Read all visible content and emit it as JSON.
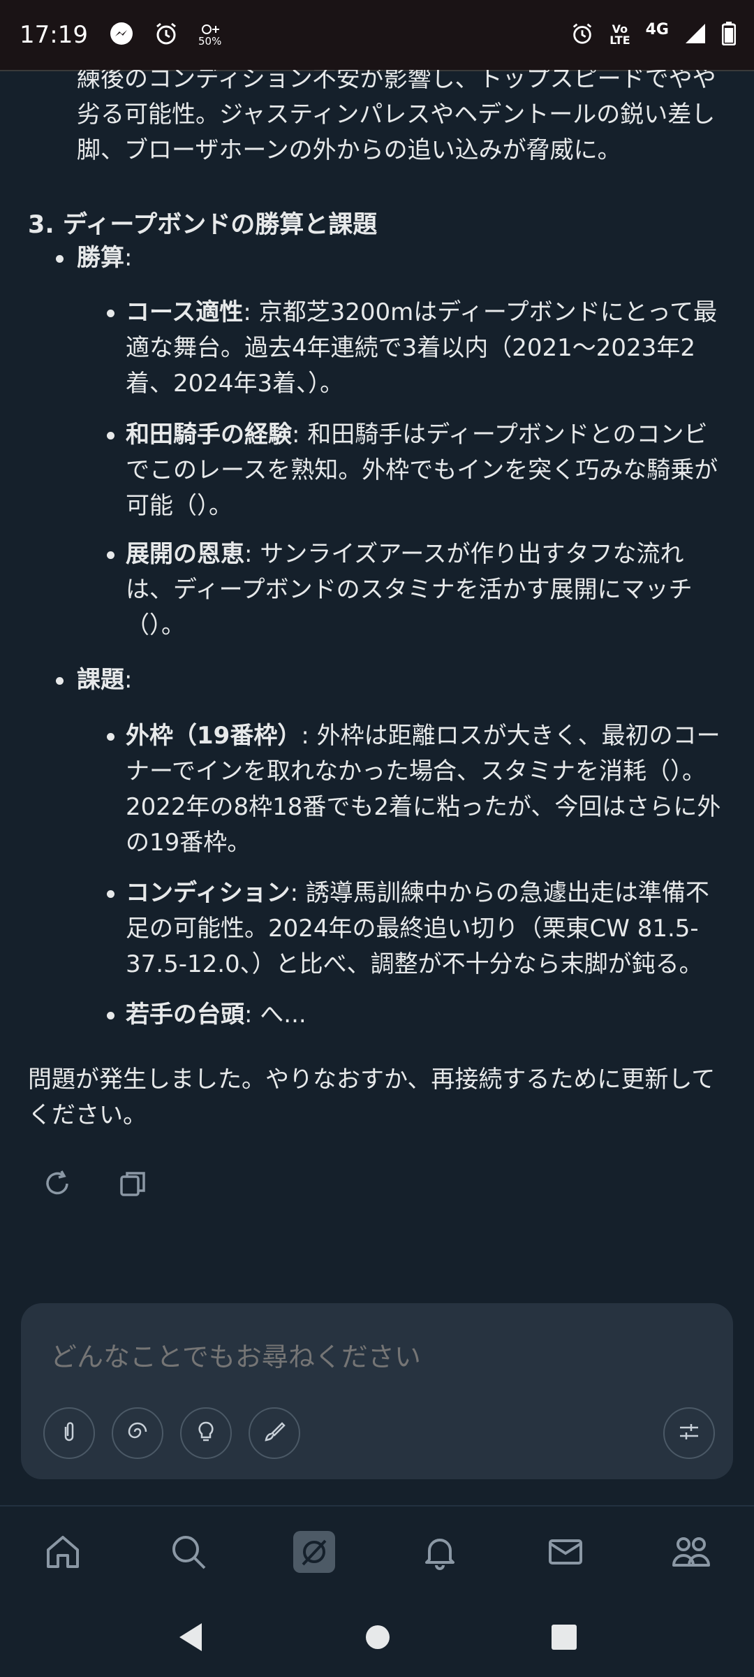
{
  "status_bar": {
    "time": "17:19",
    "icons_left": [
      "messenger-icon",
      "alarm-icon",
      "data-saver-icon"
    ],
    "data_saver_label": "50%",
    "icons_right": [
      "alarm-icon",
      "volte-icon",
      "signal-icon",
      "battery-icon"
    ],
    "volte_top": "Vo",
    "volte_bottom": "LTE",
    "network": "4G"
  },
  "message": {
    "continued_paragraph": "練後のコンディション不安が影響し、トップスピードでやや劣る可能性。ジャスティンパレスやヘデントールの鋭い差し脚、ブローザホーンの外からの追い込みが脅威に。",
    "section_title": "3. ディープボンドの勝算と課題",
    "strengths": {
      "label": "勝算",
      "colon": ":",
      "items": [
        {
          "title": "コース適性",
          "text": ": 京都芝3200mはディープボンドにとって最適な舞台。過去4年連続で3着以内（2021〜2023年2着、2024年3着、）。"
        },
        {
          "title": "和田騎手の経験",
          "text": ": 和田騎手はディープボンドとのコンビでこのレースを熟知。外枠でもインを突く巧みな騎乗が可能（）。"
        },
        {
          "title": "展開の恩恵",
          "text": ": サンライズアースが作り出すタフな流れは、ディープボンドのスタミナを活かす展開にマッチ（）。"
        }
      ]
    },
    "issues": {
      "label": "課題",
      "colon": ":",
      "items": [
        {
          "title": "外枠（19番枠）",
          "text": ": 外枠は距離ロスが大きく、最初のコーナーでインを取れなかった場合、スタミナを消耗（）。2022年の8枠18番でも2着に粘ったが、今回はさらに外の19番枠。"
        },
        {
          "title": "コンディション",
          "text": ": 誘導馬訓練中からの急遽出走は準備不足の可能性。2024年の最終追い切り（栗東CW 81.5-37.5-12.0、）と比べ、調整が不十分なら末脚が鈍る。"
        },
        {
          "title": "若手の台頭",
          "text": ": へ..."
        }
      ]
    },
    "error_text": "問題が発生しました。やりなおすか、再接続するために更新してください。"
  },
  "composer": {
    "placeholder": "どんなことでもお尋ねください"
  },
  "colors": {
    "background": "#15202b",
    "composer_bg": "#273340",
    "text": "#e7e9ea",
    "muted": "#8b98a5"
  }
}
